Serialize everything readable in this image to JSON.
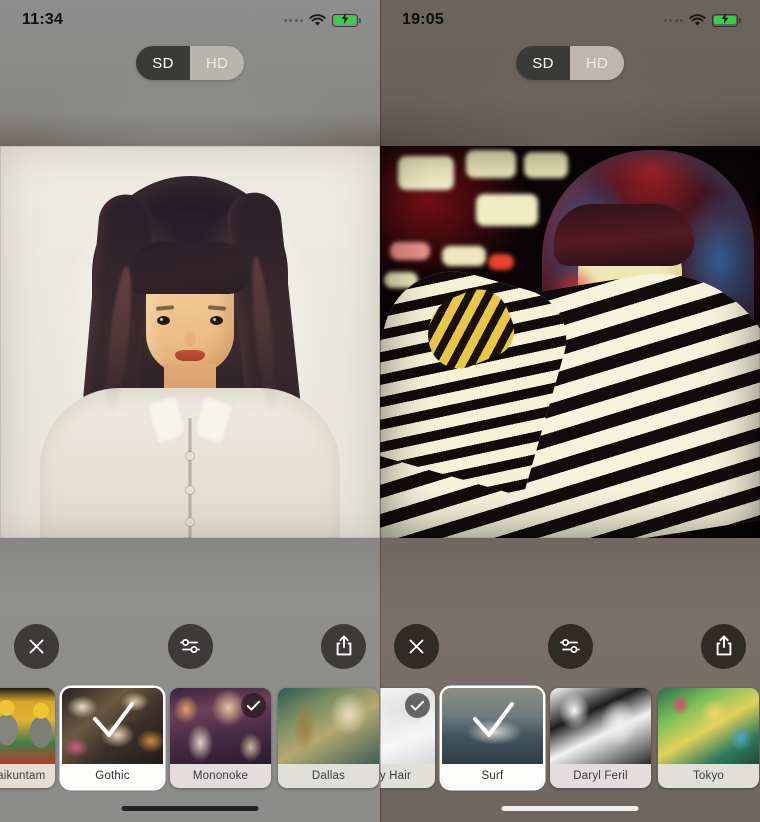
{
  "panels": [
    {
      "id": "left",
      "status": {
        "time": "11:34",
        "wifi_icon": "wifi-icon",
        "battery_icon": "battery-charging-icon",
        "signal_icon": "signal-dots-icon"
      },
      "quality_toggle": {
        "active": "SD",
        "options": [
          "SD",
          "HD"
        ]
      },
      "photo": {
        "alt": "stylized painterly portrait of woman with long dark hair on cream background"
      },
      "toolbar": {
        "close_label": "close-icon",
        "adjust_label": "sliders-icon",
        "share_label": "share-icon"
      },
      "filters": [
        {
          "name": "Thota Vaikuntam",
          "display": "hota Vaikuntam",
          "selected": false,
          "badge": false,
          "art": "th-vaikuntam",
          "tint": "tint-a",
          "clipped": true
        },
        {
          "name": "Gothic",
          "display": "Gothic",
          "selected": true,
          "badge": false,
          "art": "th-gothic",
          "tint": "tint-c",
          "clipped": false
        },
        {
          "name": "Mononoke",
          "display": "Mononoke",
          "selected": false,
          "badge": true,
          "art": "th-mononoke",
          "tint": "tint-b",
          "clipped": false
        },
        {
          "name": "Dallas",
          "display": "Dallas",
          "selected": false,
          "badge": false,
          "art": "th-dallas",
          "tint": "tint-c",
          "clipped": false
        }
      ],
      "home_indicator": "dark"
    },
    {
      "id": "right",
      "status": {
        "time": "19:05",
        "wifi_icon": "wifi-icon",
        "battery_icon": "battery-charging-icon",
        "signal_icon": "signal-dots-icon"
      },
      "quality_toggle": {
        "active": "SD",
        "options": [
          "SD",
          "HD"
        ]
      },
      "photo": {
        "alt": "high-contrast stylized portrait of woman in black and white striped shirt with red and blue tones"
      },
      "toolbar": {
        "close_label": "close-icon",
        "adjust_label": "sliders-icon",
        "share_label": "share-icon"
      },
      "filters": [
        {
          "name": "Curly Hair",
          "display": "Curly Hair",
          "selected": false,
          "badge": true,
          "art": "th-curly",
          "tint": "tint-c",
          "clipped": true
        },
        {
          "name": "Surf",
          "display": "Surf",
          "selected": true,
          "badge": false,
          "art": "th-surf",
          "tint": "tint-c",
          "clipped": false
        },
        {
          "name": "Daryl Feril",
          "display": "Daryl Feril",
          "selected": false,
          "badge": false,
          "art": "th-daryl",
          "tint": "tint-b",
          "clipped": false
        },
        {
          "name": "Tokyo",
          "display": "Tokyo",
          "selected": false,
          "badge": false,
          "art": "th-tokyo",
          "tint": "tint-c",
          "clipped": false
        }
      ],
      "home_indicator": "light"
    }
  ],
  "colors": {
    "battery_green": "#37d04a",
    "toggle_active_bg": "#3a3a38",
    "toggle_inactive_bg": "#b8b5b0",
    "toolbar_button_bg": "rgba(42,38,36,0.80)"
  }
}
